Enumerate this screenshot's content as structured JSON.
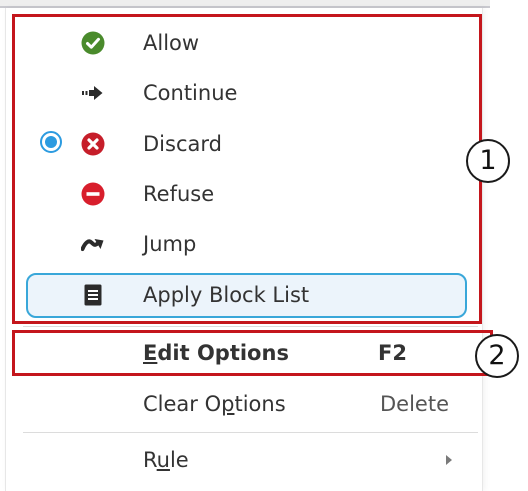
{
  "menu": {
    "items": [
      {
        "label": "Allow",
        "icon": "check-circle-icon"
      },
      {
        "label": "Continue",
        "icon": "arrow-right-icon"
      },
      {
        "label": "Discard",
        "icon": "x-circle-icon",
        "selected": true
      },
      {
        "label": "Refuse",
        "icon": "minus-circle-icon"
      },
      {
        "label": "Jump",
        "icon": "jump-arrow-icon"
      },
      {
        "label": "Apply Block List",
        "icon": "list-document-icon"
      }
    ],
    "edit_options": {
      "underline": "E",
      "rest": "dit Options",
      "shortcut": "F2"
    },
    "clear_options": {
      "before": "Clear O",
      "underline": "p",
      "after": "tions",
      "shortcut": "Delete"
    },
    "rule": {
      "before": "R",
      "underline": "u",
      "after": "le",
      "submenu_icon": "triangle-right-icon"
    }
  },
  "callouts": {
    "one": "1",
    "two": "2"
  },
  "colors": {
    "highlight_box": "#c4161c",
    "focus_border": "#39a7d9",
    "radio_accent": "#2c9be0",
    "allow_green": "#4a8b2c",
    "discard_red": "#c61e2a",
    "refuse_red": "#d81e2c"
  }
}
